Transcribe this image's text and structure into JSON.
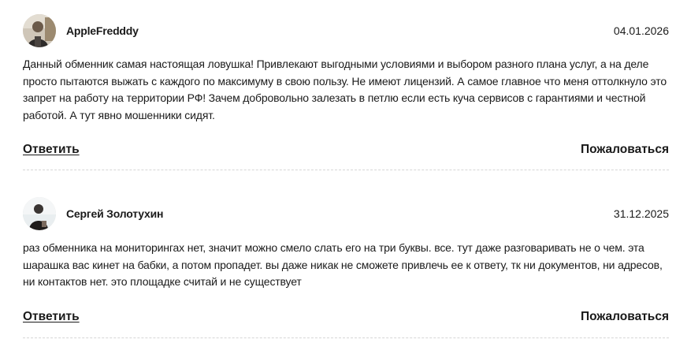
{
  "comments": [
    {
      "author": "AppleFredddy",
      "date": "04.01.2026",
      "text": "Данный обменник самая настоящая ловушка! Привлекают выгодными условиями и выбором разного плана услуг, а на деле просто пытаются выжать с каждого по максимуму в свою пользу. Не имеют лицензий. А самое главное что меня оттолкнуло это запрет на работу на территории РФ! Зачем добровольно залезать в петлю если есть куча сервисов с гарантиями и честной работой. А тут явно мошенники сидят.",
      "reply_label": "Ответить",
      "report_label": "Пожаловаться"
    },
    {
      "author": "Сергей Золотухин",
      "date": "31.12.2025",
      "text": "раз обменника на мониторингах нет, значит можно смело слать его на три буквы. все. тут даже разговаривать не о чем. эта шарашка вас кинет на бабки, а потом пропадет. вы даже никак не сможете привлечь ее к ответу, тк ни документов, ни адресов, ни контактов нет. это площадке считай и не существует",
      "reply_label": "Ответить",
      "report_label": "Пожаловаться"
    }
  ]
}
